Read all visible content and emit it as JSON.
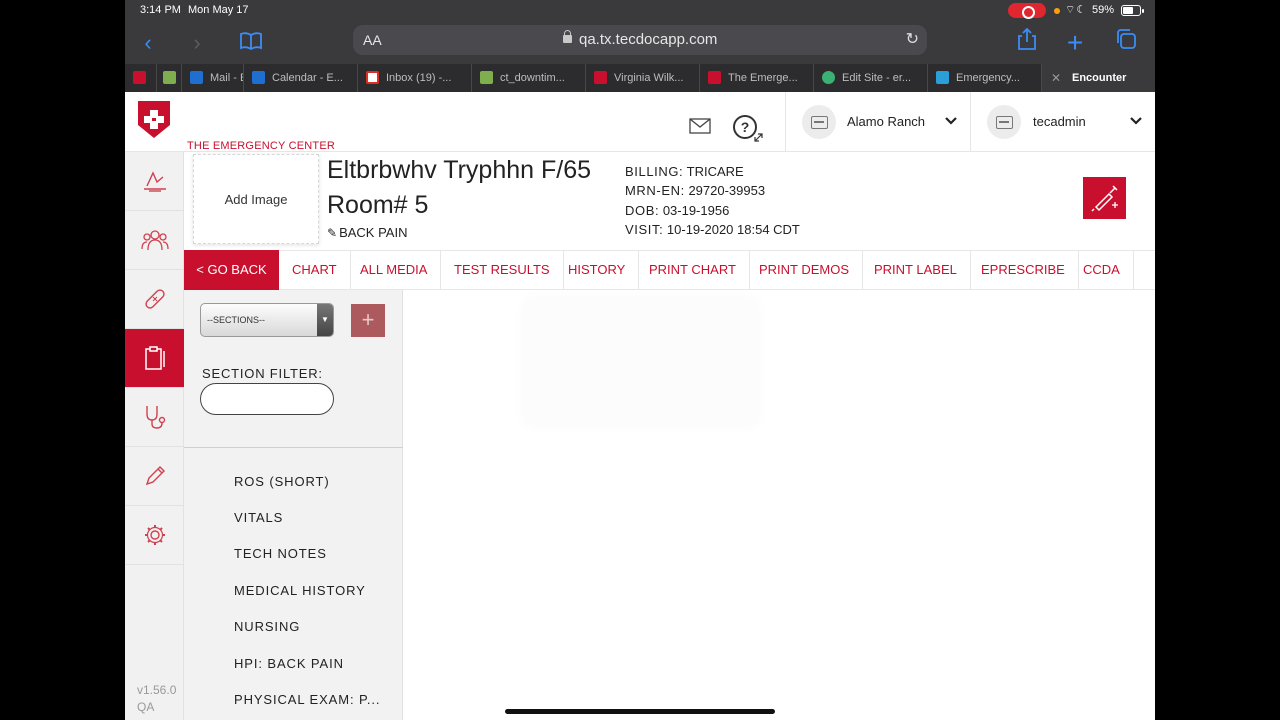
{
  "status": {
    "time": "3:14 PM",
    "date": "Mon May 17",
    "battery": "59%"
  },
  "browser": {
    "aa": "AA",
    "url": "qa.tx.tecdocapp.com",
    "tabs": [
      {
        "label": "",
        "fav": "#c8102e"
      },
      {
        "label": "",
        "fav": "#7fae4e"
      },
      {
        "label": "Mail - E",
        "fav": "#1e6fd0"
      },
      {
        "label": "Calendar - E...",
        "fav": "#1e6fd0"
      },
      {
        "label": "Inbox (19) -...",
        "fav": "#d93025"
      },
      {
        "label": "ct_downtim...",
        "fav": "#7fae4e"
      },
      {
        "label": "Virginia Wilk...",
        "fav": "#c8102e"
      },
      {
        "label": "The Emerge...",
        "fav": "#c8102e"
      },
      {
        "label": "Edit Site - er...",
        "fav": "#3bb273"
      },
      {
        "label": "Emergency...",
        "fav": "#2a9fd8"
      },
      {
        "label": "Encounter",
        "fav": ""
      }
    ]
  },
  "header": {
    "brand": "THE EMERGENCY CENTER",
    "location": "Alamo Ranch",
    "user": "tecadmin"
  },
  "patient": {
    "add_image": "Add Image",
    "name": "Eltbrbwhv Tryphhn F/65",
    "room": "Room# 5",
    "complaint": "BACK PAIN",
    "billing_label": "BILLING:",
    "billing": "TRICARE",
    "mrn_label": "MRN-EN:",
    "mrn": "29720-39953",
    "dob_label": "DOB:",
    "dob": "03-19-1956",
    "visit_label": "VISIT:",
    "visit": "10-19-2020 18:54 CDT"
  },
  "nav": {
    "go_back": "< GO BACK",
    "links": [
      "CHART",
      "ALL MEDIA",
      "TEST RESULTS",
      "HISTORY",
      "PRINT CHART",
      "PRINT DEMOS",
      "PRINT LABEL",
      "EPRESCRIBE",
      "CCDA"
    ]
  },
  "sections": {
    "select_value": "--SECTIONS--",
    "add": "+",
    "filter_label": "SECTION FILTER:",
    "items": [
      "ROS (SHORT)",
      "VITALS",
      "TECH NOTES",
      "MEDICAL HISTORY",
      "NURSING",
      "HPI: BACK PAIN",
      "PHYSICAL EXAM: P..."
    ]
  },
  "version": {
    "line1": "v1.56.0",
    "line2": "QA"
  },
  "colors": {
    "brand_red": "#c8102e",
    "safari_bar": "#3a3a3c",
    "link_blue": "#3b8cf7"
  }
}
